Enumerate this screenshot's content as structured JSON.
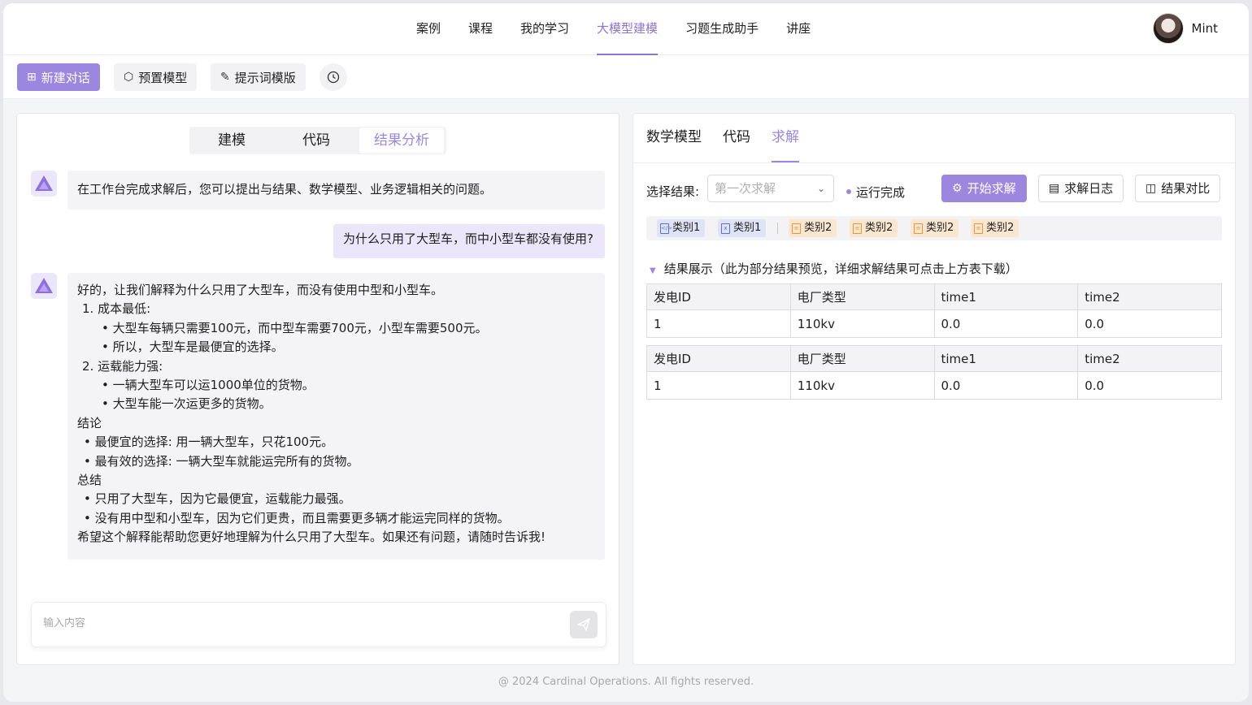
{
  "nav": {
    "items": [
      "案例",
      "课程",
      "我的学习",
      "大模型建模",
      "习题生成助手",
      "讲座"
    ],
    "active": "大模型建模",
    "user": "Mint"
  },
  "toolbar": {
    "new_chat": "新建对话",
    "preset_model": "预置模型",
    "prompt_template": "提示词模版"
  },
  "left": {
    "tabs": [
      "建模",
      "代码",
      "结果分析"
    ],
    "active_tab": "结果分析",
    "bot_intro": "在工作台完成求解后，您可以提出与结果、数学模型、业务逻辑相关的问题。",
    "user_question": "为什么只用了大型车，而中小型车都没有使用?",
    "answer_lines": [
      "好的，让我们解释为什么只用了大型车，而没有使用中型和小型车。",
      "1. 成本最低:",
      "• 大型车每辆只需要100元，而中型车需要700元，小型车需要500元。",
      "• 所以，大型车是最便宜的选择。",
      "2. 运载能力强:",
      "• 一辆大型车可以运1000单位的货物。",
      "• 大型车能一次运更多的货物。",
      "结论",
      "• 最便宜的选择: 用一辆大型车，只花100元。",
      "• 最有效的选择: 一辆大型车就能运完所有的货物。",
      "总结",
      "• 只用了大型车，因为它最便宜，运载能力最强。",
      "• 没有用中型和小型车，因为它们更贵，而且需要更多辆才能运完同样的货物。",
      "希望这个解释能帮助您更好地理解为什么只用了大型车。如果还有问题，请随时告诉我!"
    ],
    "input_placeholder": "输入内容"
  },
  "right": {
    "tabs": [
      "数学模型",
      "代码",
      "求解"
    ],
    "active_tab": "求解",
    "select_label": "选择结果:",
    "select_placeholder": "第一次求解",
    "status": "运行完成",
    "start_btn": "开始求解",
    "log_btn": "求解日志",
    "compare_btn": "结果对比",
    "files": [
      {
        "label": "类别1",
        "type": "code"
      },
      {
        "label": "类别1",
        "type": "excel"
      },
      {
        "label": "类别2",
        "type": "doc"
      },
      {
        "label": "类别2",
        "type": "doc"
      },
      {
        "label": "类别2",
        "type": "doc"
      },
      {
        "label": "类别2",
        "type": "doc"
      }
    ],
    "result_title": "结果展示（此为部分结果预览，详细求解结果可点击上方表下载）",
    "tables": [
      {
        "headers": [
          "发电ID",
          "电厂类型",
          "time1",
          "time2"
        ],
        "rows": [
          [
            "1",
            "110kv",
            "0.0",
            "0.0"
          ]
        ]
      },
      {
        "headers": [
          "发电ID",
          "电厂类型",
          "time1",
          "time2"
        ],
        "rows": [
          [
            "1",
            "110kv",
            "0.0",
            "0.0"
          ]
        ]
      }
    ]
  },
  "footer": "@ 2024 Cardinal Operations. All fights reserved.",
  "colors": {
    "accent": "#9b87e0",
    "user_bubble": "#ece6fb",
    "bot_bubble": "#f4f4f6"
  }
}
